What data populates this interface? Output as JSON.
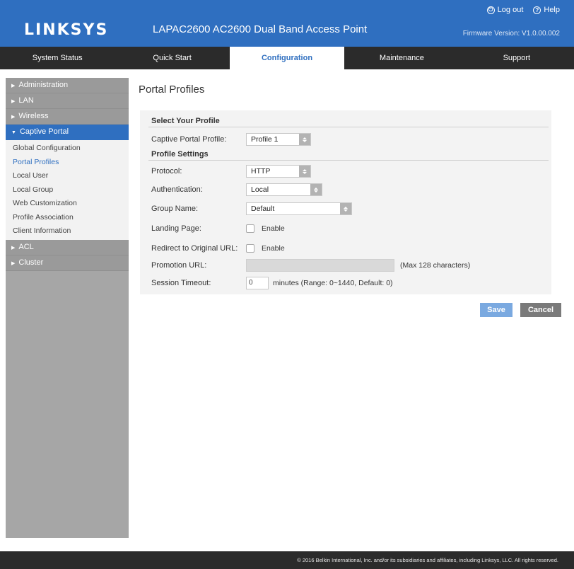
{
  "header": {
    "logo": "LINKSYS",
    "product_title": "LAPAC2600 AC2600 Dual Band Access Point",
    "logout_label": "Log out",
    "help_label": "Help",
    "firmware": "Firmware Version: V1.0.00.002"
  },
  "nav": {
    "tabs": [
      {
        "label": "System Status"
      },
      {
        "label": "Quick Start"
      },
      {
        "label": "Configuration",
        "active": true
      },
      {
        "label": "Maintenance"
      },
      {
        "label": "Support"
      }
    ]
  },
  "sidebar": {
    "items": [
      {
        "label": "Administration"
      },
      {
        "label": "LAN"
      },
      {
        "label": "Wireless"
      },
      {
        "label": "Captive Portal",
        "active": true
      },
      {
        "label": "ACL"
      },
      {
        "label": "Cluster"
      }
    ],
    "captive_portal_sub": [
      {
        "label": "Global Configuration"
      },
      {
        "label": "Portal Profiles",
        "active": true
      },
      {
        "label": "Local User"
      },
      {
        "label": "Local Group"
      },
      {
        "label": "Web Customization"
      },
      {
        "label": "Profile Association"
      },
      {
        "label": "Client Information"
      }
    ]
  },
  "main": {
    "page_title": "Portal Profiles",
    "select_profile_heading": "Select Your Profile",
    "captive_portal_profile_label": "Captive Portal Profile:",
    "captive_portal_profile_value": "Profile 1",
    "profile_settings_heading": "Profile Settings",
    "protocol_label": "Protocol:",
    "protocol_value": "HTTP",
    "authentication_label": "Authentication:",
    "authentication_value": "Local",
    "group_name_label": "Group Name:",
    "group_name_value": "Default",
    "landing_page_label": "Landing Page:",
    "landing_page_check_label": "Enable",
    "redirect_label": "Redirect to Original URL:",
    "redirect_check_label": "Enable",
    "promotion_url_label": "Promotion URL:",
    "promotion_url_value": "",
    "promotion_url_hint": "(Max 128 characters)",
    "session_timeout_label": "Session Timeout:",
    "session_timeout_value": "0",
    "session_timeout_hint": "minutes (Range: 0~1440, Default: 0)",
    "save_label": "Save",
    "cancel_label": "Cancel"
  },
  "footer": {
    "copyright": "© 2016 Belkin International, Inc. and/or its subsidiaries and affiliates, including Linksys, LLC. All rights reserved."
  },
  "colors": {
    "brand_blue": "#2f6fc0",
    "nav_dark": "#2b2b2b",
    "sidebar_gray": "#a6a6a6",
    "save_button": "#7aa9e0",
    "cancel_button": "#7a7a7a"
  }
}
